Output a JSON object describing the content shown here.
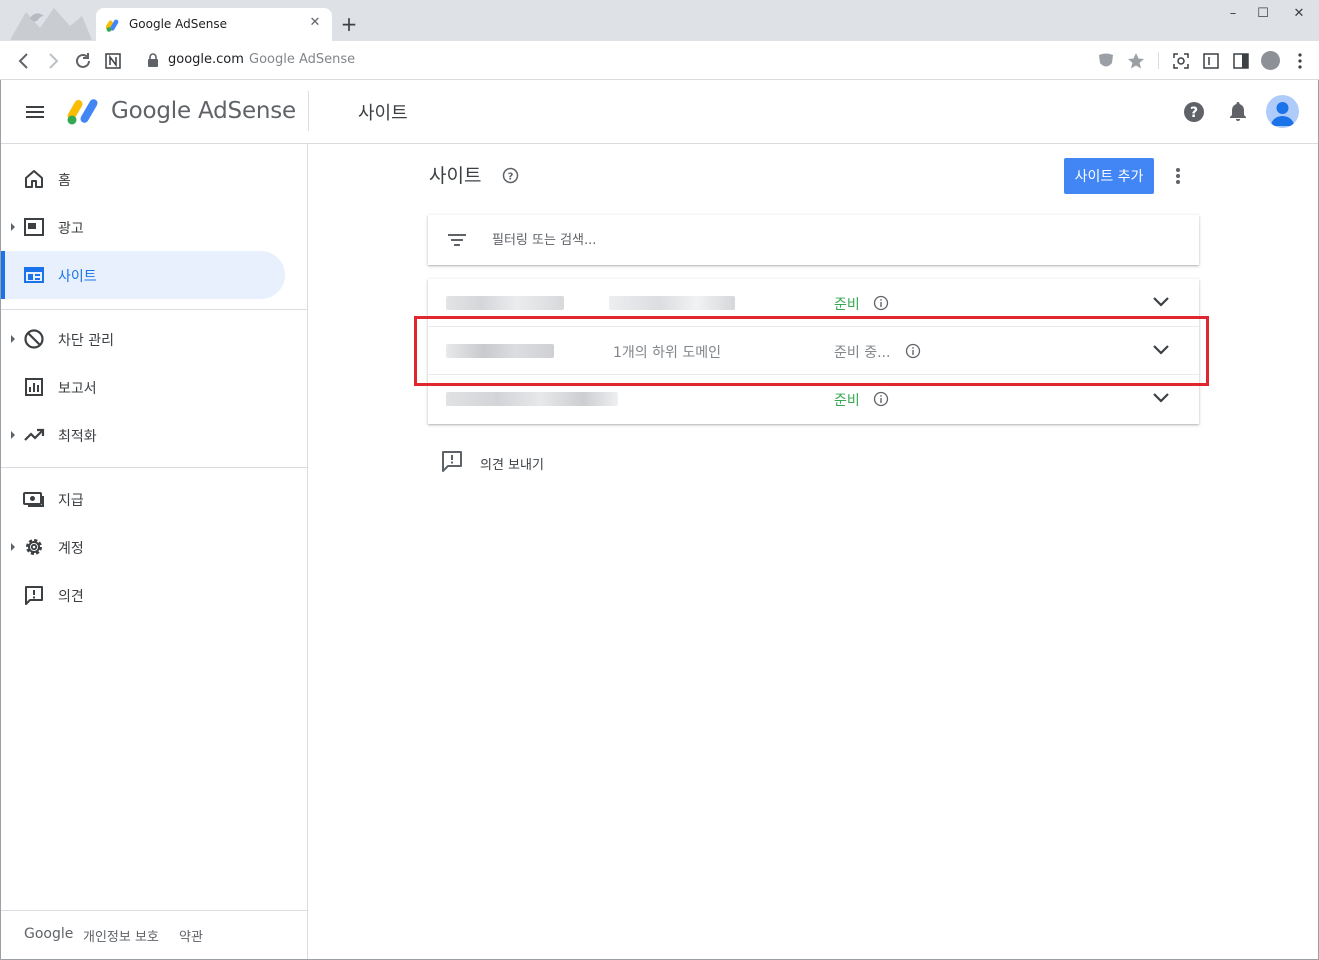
{
  "browser": {
    "tab_title": "Google AdSense",
    "url_host": "google.com",
    "url_page_title": "Google AdSense"
  },
  "header": {
    "logo_text": "Google AdSense",
    "section_title": "사이트"
  },
  "sidebar": {
    "items": [
      {
        "label": "홈",
        "icon": "home-icon"
      },
      {
        "label": "광고",
        "icon": "ads-icon"
      },
      {
        "label": "사이트",
        "icon": "sites-icon"
      },
      {
        "label": "차단 관리",
        "icon": "block-icon"
      },
      {
        "label": "보고서",
        "icon": "reports-icon"
      },
      {
        "label": "최적화",
        "icon": "trending-icon"
      },
      {
        "label": "지급",
        "icon": "payments-icon"
      },
      {
        "label": "계정",
        "icon": "gear-icon"
      },
      {
        "label": "의견",
        "icon": "feedback-icon"
      }
    ],
    "active_item": "사이트",
    "footer": {
      "brand": "Google",
      "privacy": "개인정보 보호",
      "terms": "약관"
    }
  },
  "main": {
    "title": "사이트",
    "add_site_label": "사이트 추가",
    "filter_placeholder": "필터링 또는 검색...",
    "sites": [
      {
        "subdomains": "",
        "status": "준비",
        "status_type": "ready"
      },
      {
        "subdomains": "1개의 하위 도메인",
        "status": "준비 중...",
        "status_type": "pending"
      },
      {
        "subdomains": "",
        "status": "준비",
        "status_type": "ready"
      }
    ],
    "feedback_label": "의견 보내기"
  },
  "colors": {
    "accent": "#1a73e8",
    "button": "#4285f4",
    "ready": "#34a853",
    "highlight": "#e0262f"
  }
}
